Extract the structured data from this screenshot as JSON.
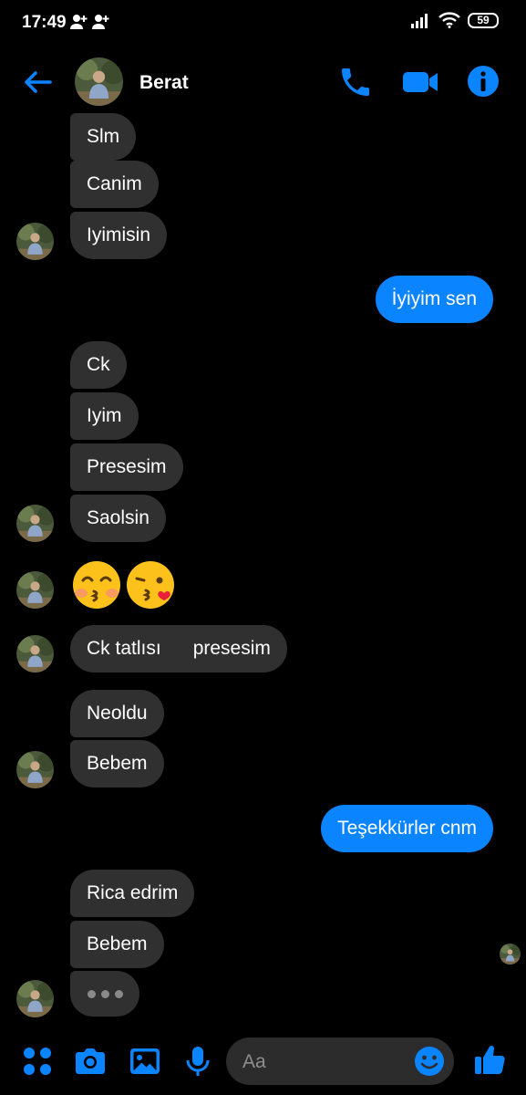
{
  "status_bar": {
    "time": "17:49",
    "battery": "59"
  },
  "header": {
    "contact_name": "Berat"
  },
  "messages": {
    "m1": "Slm",
    "m2": "Canim",
    "m3": "Iyimisin",
    "m4": "İyiyim sen",
    "m5": "Ck",
    "m6": "Iyim",
    "m7": "Presesim",
    "m8": "Saolsin",
    "m9": "Ck tatlısı      presesim",
    "m10": "Neoldu",
    "m11": "Bebem",
    "m12": "Teşekkürler cnm",
    "m13": "Rica edrim",
    "m14": "Bebem"
  },
  "composer": {
    "placeholder": "Aa"
  },
  "colors": {
    "accent": "#0a84ff",
    "incoming_bubble": "#303030",
    "background": "#000000"
  }
}
